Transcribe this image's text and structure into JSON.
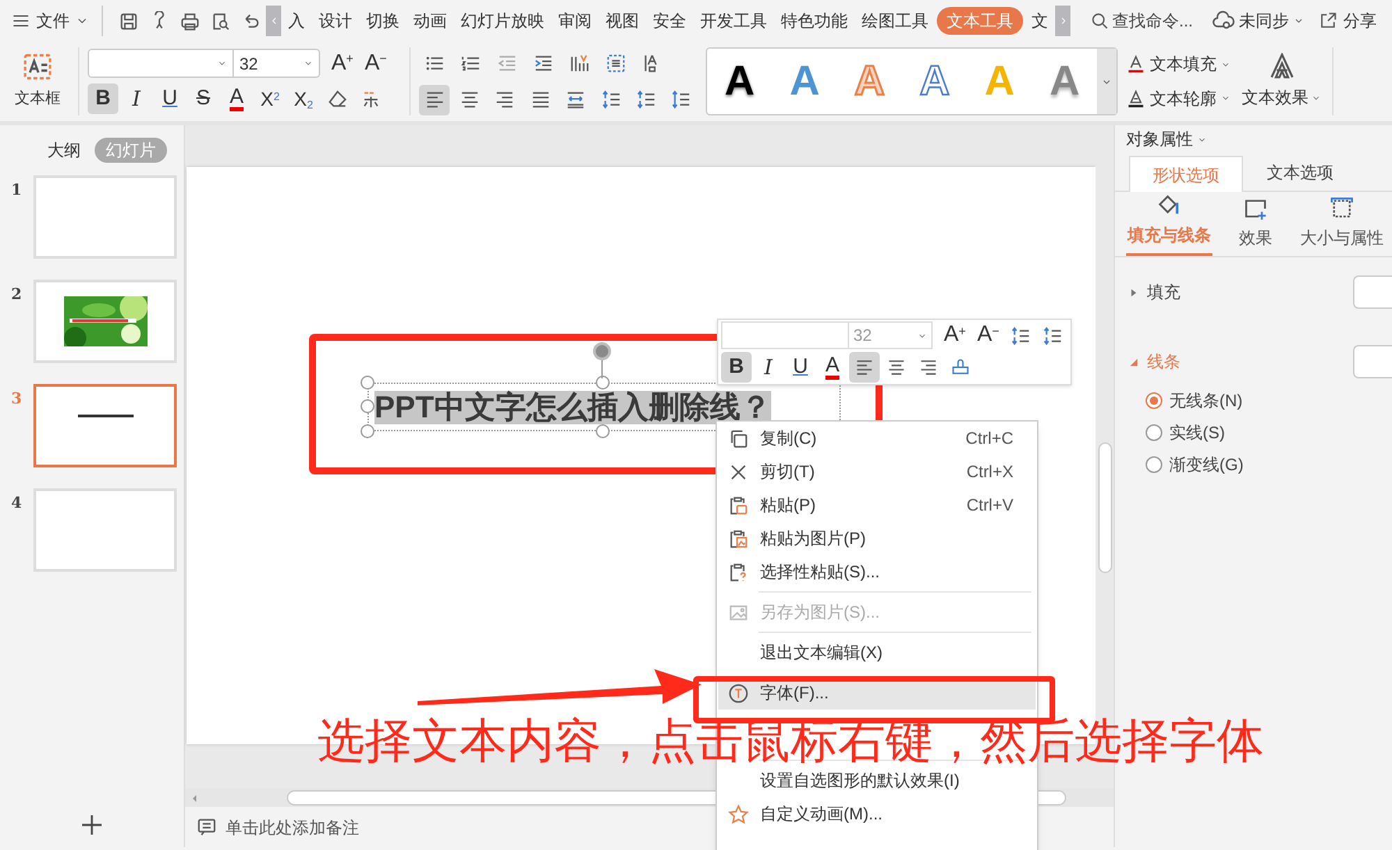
{
  "menu_bar": {
    "file_label": "文件",
    "tabs": [
      {
        "label": "入",
        "selected": false
      },
      {
        "label": "设计",
        "selected": false
      },
      {
        "label": "切换",
        "selected": false
      },
      {
        "label": "动画",
        "selected": false
      },
      {
        "label": "幻灯片放映",
        "selected": false
      },
      {
        "label": "审阅",
        "selected": false
      },
      {
        "label": "视图",
        "selected": false
      },
      {
        "label": "安全",
        "selected": false
      },
      {
        "label": "开发工具",
        "selected": false
      },
      {
        "label": "特色功能",
        "selected": false
      },
      {
        "label": "绘图工具",
        "selected": false
      },
      {
        "label": "文本工具",
        "selected": true
      },
      {
        "label": "文",
        "selected": false
      }
    ],
    "search_placeholder": "查找命令...",
    "sync_label": "未同步",
    "share_label": "分享"
  },
  "ribbon": {
    "textbox_label": "文本框",
    "font_size": "32",
    "size_buttons": [
      {
        "label": "A$^{+}$"
      },
      {
        "label": "A$^{−}$"
      }
    ],
    "format_buttons": [
      {
        "kind": "bold",
        "label": "B",
        "selected": true
      },
      {
        "kind": "italic",
        "label": "I",
        "selected": false
      },
      {
        "kind": "underline",
        "label": "U",
        "selected": false
      },
      {
        "kind": "strike",
        "label": "S",
        "selected": false
      },
      {
        "kind": "font-color",
        "label": "A",
        "selected": false
      },
      {
        "kind": "script",
        "label": "X$^{2}$",
        "selected": false
      },
      {
        "kind": "script",
        "label": "X$_{2}$",
        "selected": false
      },
      {
        "kind": "eraser",
        "selected": false
      },
      {
        "kind": "phonetic",
        "selected": false
      }
    ],
    "paragraph_row_1": [
      {
        "kind": "bullets",
        "selected": false
      },
      {
        "kind": "numbering",
        "selected": false
      },
      {
        "kind": "outdent",
        "selected": false
      },
      {
        "kind": "indent",
        "selected": false
      },
      {
        "kind": "columns",
        "selected": false
      },
      {
        "kind": "text-align",
        "selected": false
      },
      {
        "kind": "direction",
        "selected": false
      }
    ],
    "paragraph_row_2": [
      {
        "kind": "align-left",
        "selected": true
      },
      {
        "kind": "align-center",
        "selected": false
      },
      {
        "kind": "align-right",
        "selected": false
      },
      {
        "kind": "justify",
        "selected": false
      },
      {
        "kind": "distribute",
        "selected": false
      },
      {
        "kind": "spacing",
        "selected": false
      },
      {
        "kind": "spacing",
        "selected": false
      },
      {
        "kind": "line-spacing",
        "selected": false
      }
    ],
    "style_gallery": [
      {
        "kind": "black",
        "label": "A"
      },
      {
        "kind": "blue",
        "label": "A"
      },
      {
        "kind": "orange-outline",
        "label": "A"
      },
      {
        "kind": "blue-outline",
        "label": "A"
      },
      {
        "kind": "yellow",
        "label": "A"
      },
      {
        "kind": "gray",
        "label": "A"
      }
    ],
    "text_commands": [
      {
        "kind": "fill",
        "label": "文本填充"
      },
      {
        "kind": "outline",
        "label": "文本轮廓"
      },
      {
        "kind": "effect",
        "label": "文本效果"
      }
    ]
  },
  "slide_panel": {
    "tabs": [
      {
        "label": "大纲",
        "selected": false
      },
      {
        "label": "幻灯片",
        "selected": true
      }
    ],
    "slides": [
      {
        "number": "1",
        "kind": "blank",
        "selected": false
      },
      {
        "number": "2",
        "kind": "picture",
        "selected": false
      },
      {
        "number": "3",
        "kind": "title",
        "selected": true
      },
      {
        "number": "4",
        "kind": "blank",
        "selected": false
      }
    ]
  },
  "slide": {
    "title": "PPT中文字怎么插入删除线？"
  },
  "mini_toolbar": {
    "font_size": "32",
    "size_buttons": [
      {
        "label": "A$^{+}$"
      },
      {
        "label": "A$^{−}$"
      }
    ],
    "buttons": [
      {
        "kind": "bold",
        "label": "B",
        "selected": true
      },
      {
        "kind": "italic",
        "label": "I",
        "selected": false
      },
      {
        "kind": "underline",
        "label": "U",
        "selected": false
      },
      {
        "kind": "font-color",
        "label": "A",
        "selected": false
      },
      {
        "kind": "align-left",
        "selected": true
      },
      {
        "kind": "align-center",
        "selected": false
      },
      {
        "kind": "align-right",
        "selected": false
      },
      {
        "kind": "format-painter",
        "selected": false
      }
    ]
  },
  "context_menu": {
    "items": [
      {
        "kind": "copy",
        "label": "复制(C)",
        "shortcut": "Ctrl+C",
        "disabled": false,
        "selected": false
      },
      {
        "kind": "cut",
        "label": "剪切(T)",
        "shortcut": "Ctrl+X",
        "disabled": false,
        "selected": false
      },
      {
        "kind": "paste",
        "label": "粘贴(P)",
        "shortcut": "Ctrl+V",
        "disabled": false,
        "selected": false
      },
      {
        "kind": "paste-picture",
        "label": "粘贴为图片(P)",
        "disabled": false,
        "selected": false
      },
      {
        "kind": "paste-special",
        "label": "选择性粘贴(S)...",
        "disabled": false,
        "selected": false
      },
      {
        "kind": "separator"
      },
      {
        "kind": "save-picture",
        "label": "另存为图片(S)...",
        "disabled": true,
        "selected": false
      },
      {
        "kind": "separator"
      },
      {
        "kind": "plain",
        "label": "退出文本编辑(X)",
        "disabled": false,
        "selected": false
      },
      {
        "kind": "font",
        "label": "字体(F)...",
        "disabled": false,
        "selected": true
      }
    ],
    "lower_items": [
      {
        "kind": "separator"
      },
      {
        "kind": "plain",
        "label": "设置自选图形的默认效果(I)",
        "disabled": false,
        "selected": false
      },
      {
        "kind": "animation",
        "label": "自定义动画(M)...",
        "disabled": false,
        "selected": false
      }
    ]
  },
  "notes_placeholder": "单击此处添加备注",
  "properties_panel": {
    "title": "对象属性",
    "tabs": [
      {
        "label": "形状选项",
        "selected": true
      },
      {
        "label": "文本选项",
        "selected": false
      }
    ],
    "subtabs": [
      {
        "kind": "fill-line",
        "label": "填充与线条",
        "selected": true
      },
      {
        "kind": "effect",
        "label": "效果",
        "selected": false
      },
      {
        "kind": "size",
        "label": "大小与属性",
        "selected": false
      }
    ],
    "sections": [
      {
        "label": "填充",
        "expanded": false
      },
      {
        "label": "线条",
        "expanded": true
      }
    ],
    "line_options": [
      {
        "label": "无线条(N)",
        "selected": true
      },
      {
        "label": "实线(S)",
        "selected": false
      },
      {
        "label": "渐变线(G)",
        "selected": false
      }
    ]
  },
  "annotation": {
    "caption": "选择文本内容，点击鼠标右键，然后选择字体"
  }
}
